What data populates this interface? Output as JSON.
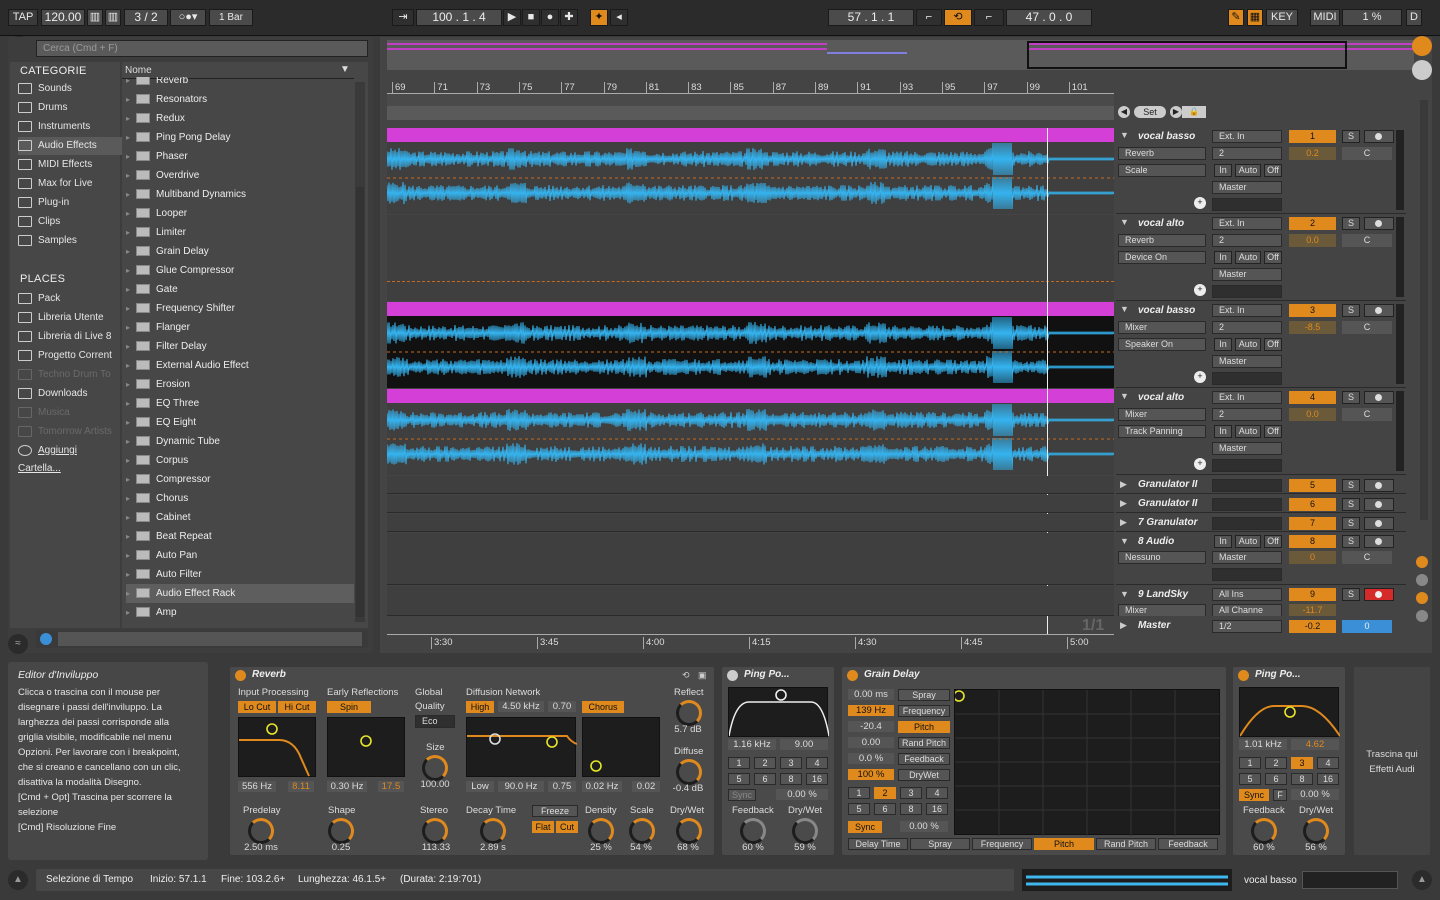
{
  "transport": {
    "tap": "TAP",
    "tempo": "120.00",
    "signature": "3 / 2",
    "quant": "1 Bar",
    "position": "100 . 1 . 4",
    "loop_start": "57 . 1 . 1",
    "loop_len": "47 . 0 . 0",
    "key": "KEY",
    "midi": "MIDI",
    "cpu": "1 %",
    "d": "D"
  },
  "browser": {
    "search_placeholder": "Cerca (Cmd + F)",
    "categories_title": "CATEGORIE",
    "name_col": "Nome",
    "categories": [
      "Sounds",
      "Drums",
      "Instruments",
      "Audio Effects",
      "MIDI Effects",
      "Max for Live",
      "Plug-in",
      "Clips",
      "Samples"
    ],
    "places_title": "PLACES",
    "places": [
      "Pack",
      "Libreria Utente",
      "Libreria di Live 8",
      "Progetto Corrent",
      "Techno Drum To",
      "Downloads",
      "Musica",
      "Tomorrow Artists",
      "Aggiungi Cartella..."
    ],
    "files": [
      "Reverb",
      "Resonators",
      "Redux",
      "Ping Pong Delay",
      "Phaser",
      "Overdrive",
      "Multiband Dynamics",
      "Looper",
      "Limiter",
      "Grain Delay",
      "Glue Compressor",
      "Gate",
      "Frequency Shifter",
      "Flanger",
      "Filter Delay",
      "External Audio Effect",
      "Erosion",
      "EQ Three",
      "EQ Eight",
      "Dynamic Tube",
      "Corpus",
      "Compressor",
      "Chorus",
      "Cabinet",
      "Beat Repeat",
      "Auto Pan",
      "Auto Filter",
      "Audio Effect Rack",
      "Amp"
    ]
  },
  "ruler": [
    "69",
    "71",
    "73",
    "75",
    "77",
    "79",
    "81",
    "83",
    "85",
    "87",
    "89",
    "91",
    "93",
    "95",
    "97",
    "99",
    "101"
  ],
  "time_ruler": [
    "3:30",
    "3:45",
    "4:00",
    "4:15",
    "4:30",
    "4:45",
    "5:00"
  ],
  "page_indicator": "1/1",
  "set_label": "Set",
  "tracks": [
    {
      "name": "vocal basso",
      "in": "Ext. In",
      "ch": "2",
      "dev": "Reverb",
      "par": "Scale",
      "num": "1",
      "vol": "0.2",
      "pan": "C",
      "out": "Master"
    },
    {
      "name": "vocal alto",
      "in": "Ext. In",
      "ch": "2",
      "dev": "Reverb",
      "par": "Device On",
      "num": "2",
      "vol": "0.0",
      "pan": "C",
      "out": "Master"
    },
    {
      "name": "vocal basso",
      "in": "Ext. In",
      "ch": "2",
      "dev": "Mixer",
      "par": "Speaker On",
      "num": "3",
      "vol": "-8.5",
      "pan": "C",
      "out": "Master"
    },
    {
      "name": "vocal alto",
      "in": "Ext. In",
      "ch": "2",
      "dev": "Mixer",
      "par": "Track Panning",
      "num": "4",
      "vol": "0.0",
      "pan": "C",
      "out": "Master"
    }
  ],
  "mon": {
    "in": "In",
    "auto": "Auto",
    "off": "Off",
    "s": "S"
  },
  "groups": [
    {
      "name": "Granulator II",
      "num": "5"
    },
    {
      "name": "Granulator II",
      "num": "6"
    },
    {
      "name": "7 Granulator",
      "num": "7"
    }
  ],
  "audio8": {
    "name": "8 Audio",
    "in": "Nessuno",
    "num": "8",
    "vol": "0",
    "pan": "C",
    "out": "Master"
  },
  "landsky": {
    "name": "9 LandSky",
    "in": "All Ins",
    "ch": "All Channe",
    "dev": "Mixer",
    "num": "9",
    "vol": "-11.7"
  },
  "master": {
    "name": "Master",
    "sel": "1/2",
    "vol": "-0.2",
    "pan": "0"
  },
  "help": {
    "title": "Editor d'Inviluppo",
    "lines": [
      "Clicca o trascina con il mouse per",
      "disegnare i passi dell'inviluppo. La",
      "larghezza dei passi corrisponde alla",
      "griglia visibile, modificabile nel menu",
      "Opzioni. Per lavorare con i breakpoint,",
      "che si creano e cancellano con un clic,",
      "disattiva la modalità Disegno.",
      "[Cmd + Opt] Trascina per scorrere la",
      "selezione",
      "[Cmd] Risoluzione Fine"
    ]
  },
  "reverb": {
    "title": "Reverb",
    "input": "Input Processing",
    "locut": "Lo Cut",
    "hicut": "Hi Cut",
    "early": "Early Reflections",
    "spin": "Spin",
    "global": "Global",
    "quality": "Quality",
    "eco": "Eco",
    "size": "Size",
    "size_v": "100.00",
    "diff": "Diffusion Network",
    "high": "High",
    "high_v": "4.50 kHz",
    "high_q": "0.70",
    "chorus": "Chorus",
    "reflect": "Reflect",
    "reflect_v": "5.7 dB",
    "diffuse": "Diffuse",
    "diffuse_v": "-0.4 dB",
    "f1": "556 Hz",
    "f1b": "8.11",
    "f2": "0.30 Hz",
    "f2b": "17.5",
    "low": "Low",
    "low_v": "90.0 Hz",
    "low_q": "0.75",
    "cho_v": "0.02 Hz",
    "cho_b": "0.02",
    "predelay": "Predelay",
    "predelay_v": "2.50 ms",
    "shape": "Shape",
    "shape_v": "0.25",
    "stereo": "Stereo",
    "stereo_v": "113.33",
    "decay": "Decay Time",
    "decay_v": "2.89 s",
    "freeze": "Freeze",
    "flat": "Flat",
    "cut": "Cut",
    "density": "Density",
    "density_v": "25 %",
    "scale": "Scale",
    "scale_v": "54 %",
    "drywet": "Dry/Wet",
    "drywet_v": "68 %"
  },
  "pp1": {
    "title": "Ping Po...",
    "f": "1.16 kHz",
    "q": "9.00",
    "n": [
      "1",
      "2",
      "3",
      "4",
      "5",
      "6",
      "8",
      "16"
    ],
    "sync": "Sync",
    "pct": "0.00 %",
    "fb": "Feedback",
    "fb_v": "60 %",
    "dw": "Dry/Wet",
    "dw_v": "59 %"
  },
  "grain": {
    "title": "Grain Delay",
    "rows": [
      [
        "0.00 ms",
        "Spray"
      ],
      [
        "139 Hz",
        "Frequency"
      ],
      [
        "-20.4",
        "Pitch"
      ],
      [
        "0.00",
        "Rand Pitch"
      ],
      [
        "0.0 %",
        "Feedback"
      ],
      [
        "100 %",
        "DryWet"
      ]
    ],
    "n": [
      "1",
      "2",
      "3",
      "4",
      "5",
      "6",
      "8",
      "16"
    ],
    "sync": "Sync",
    "sv": "0.00 %",
    "axes": [
      "Delay Time",
      "Spray",
      "Frequency",
      "Pitch",
      "Rand Pitch",
      "Feedback"
    ]
  },
  "pp2": {
    "title": "Ping Po...",
    "f": "1.01 kHz",
    "q": "4.62",
    "n": [
      "1",
      "2",
      "3",
      "4",
      "5",
      "6",
      "8",
      "16"
    ],
    "sync": "Sync",
    "fm": "F",
    "pct": "0.00 %",
    "fb": "Feedback",
    "fb_v": "60 %",
    "dw": "Dry/Wet",
    "dw_v": "56 %"
  },
  "drop_hint": [
    "Trascina qui",
    "Effetti Audi"
  ],
  "status": {
    "sel": "Selezione di Tempo",
    "start": "Inizio: 57.1.1",
    "end": "Fine: 103.2.6+",
    "len": "Lunghezza: 46.1.5+",
    "dur": "(Durata: 2:19:701)"
  },
  "status_track": "vocal basso"
}
